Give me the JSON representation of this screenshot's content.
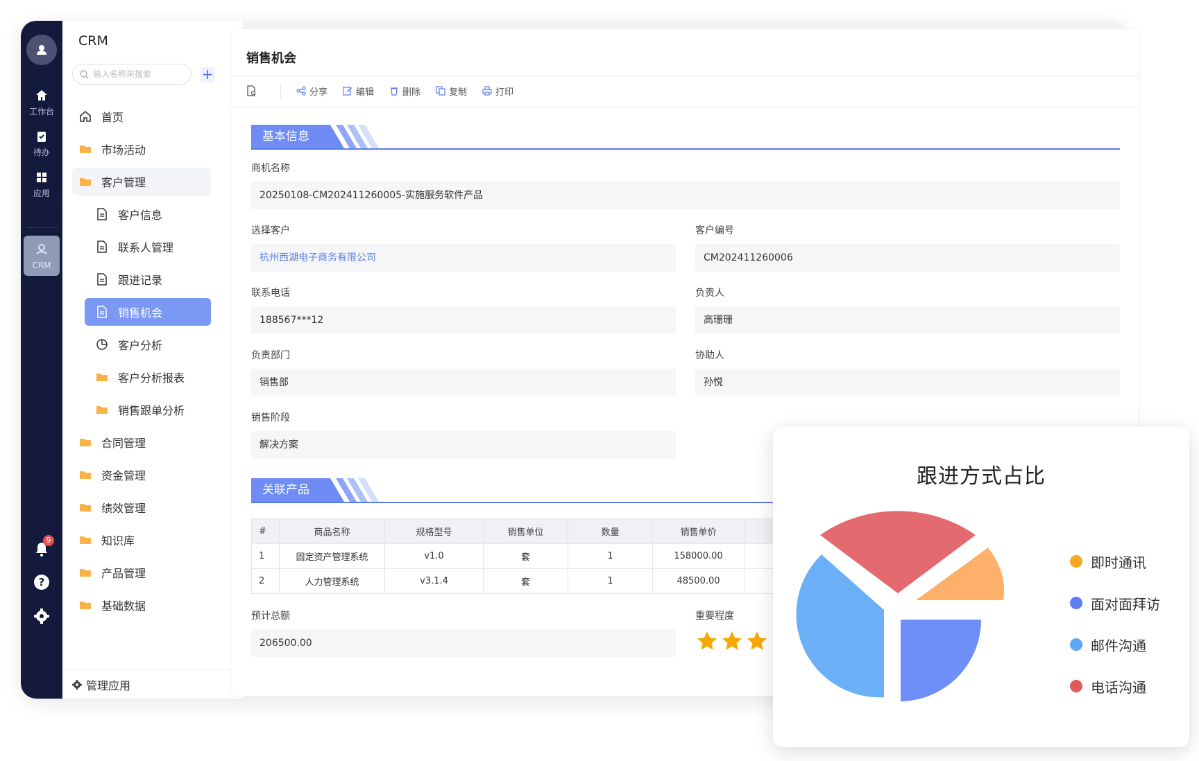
{
  "rail": {
    "items": [
      {
        "label": "工作台",
        "icon": "home-icon"
      },
      {
        "label": "待办",
        "icon": "clipboard-check-icon"
      },
      {
        "label": "应用",
        "icon": "apps-grid-icon"
      }
    ],
    "active": {
      "label": "CRM",
      "icon": "crm-user-icon"
    },
    "notification_count": "9"
  },
  "sidebar": {
    "app_title": "CRM",
    "search_placeholder": "输入名称来搜索",
    "add_label": "+",
    "items": [
      {
        "label": "首页"
      },
      {
        "label": "市场活动"
      },
      {
        "label": "客户管理"
      },
      {
        "label": "客户信息"
      },
      {
        "label": "联系人管理"
      },
      {
        "label": "跟进记录"
      },
      {
        "label": "销售机会"
      },
      {
        "label": "客户分析"
      },
      {
        "label": "客户分析报表"
      },
      {
        "label": "销售跟单分析"
      },
      {
        "label": "合同管理"
      },
      {
        "label": "资金管理"
      },
      {
        "label": "绩效管理"
      },
      {
        "label": "知识库"
      },
      {
        "label": "产品管理"
      },
      {
        "label": "基础数据"
      }
    ],
    "manage_label": "管理应用"
  },
  "page": {
    "title": "销售机会",
    "toolbar": {
      "share": "分享",
      "edit": "编辑",
      "delete": "删除",
      "copy": "复制",
      "print": "打印"
    }
  },
  "basic_info": {
    "section_title": "基本信息",
    "opportunity_name_label": "商机名称",
    "opportunity_name": "20250108-CM202411260005-实施服务软件产品",
    "customer_label": "选择客户",
    "customer": "杭州西湖电子商务有限公司",
    "customer_no_label": "客户编号",
    "customer_no": "CM202411260006",
    "phone_label": "联系电话",
    "phone": "188567***12",
    "owner_label": "负责人",
    "owner": "高珊珊",
    "department_label": "负责部门",
    "department": "销售部",
    "assistant_label": "协助人",
    "assistant": "孙悦",
    "stage_label": "销售阶段",
    "stage": "解决方案"
  },
  "products": {
    "section_title": "关联产品",
    "headers": [
      "#",
      "商品名称",
      "规格型号",
      "销售单位",
      "数量",
      "销售单价"
    ],
    "rows": [
      [
        "1",
        "固定资产管理系统",
        "v1.0",
        "套",
        "1",
        "158000.00"
      ],
      [
        "2",
        "人力管理系统",
        "v3.1.4",
        "套",
        "1",
        "48500.00"
      ]
    ],
    "total_label": "预计总额",
    "total": "206500.00",
    "importance_label": "重要程度",
    "importance_stars_visible": 3
  },
  "pie": {
    "title": "跟进方式占比",
    "legend": [
      {
        "label": "即时通讯",
        "color": "#f6a623"
      },
      {
        "label": "面对面拜访",
        "color": "#5b7ff0"
      },
      {
        "label": "邮件沟通",
        "color": "#5ea6f5"
      },
      {
        "label": "电话沟通",
        "color": "#e05a5a"
      }
    ]
  },
  "colors": {
    "accent": "#6e8cf4",
    "rail_bg": "#141a3c",
    "star": "#f6a800"
  }
}
